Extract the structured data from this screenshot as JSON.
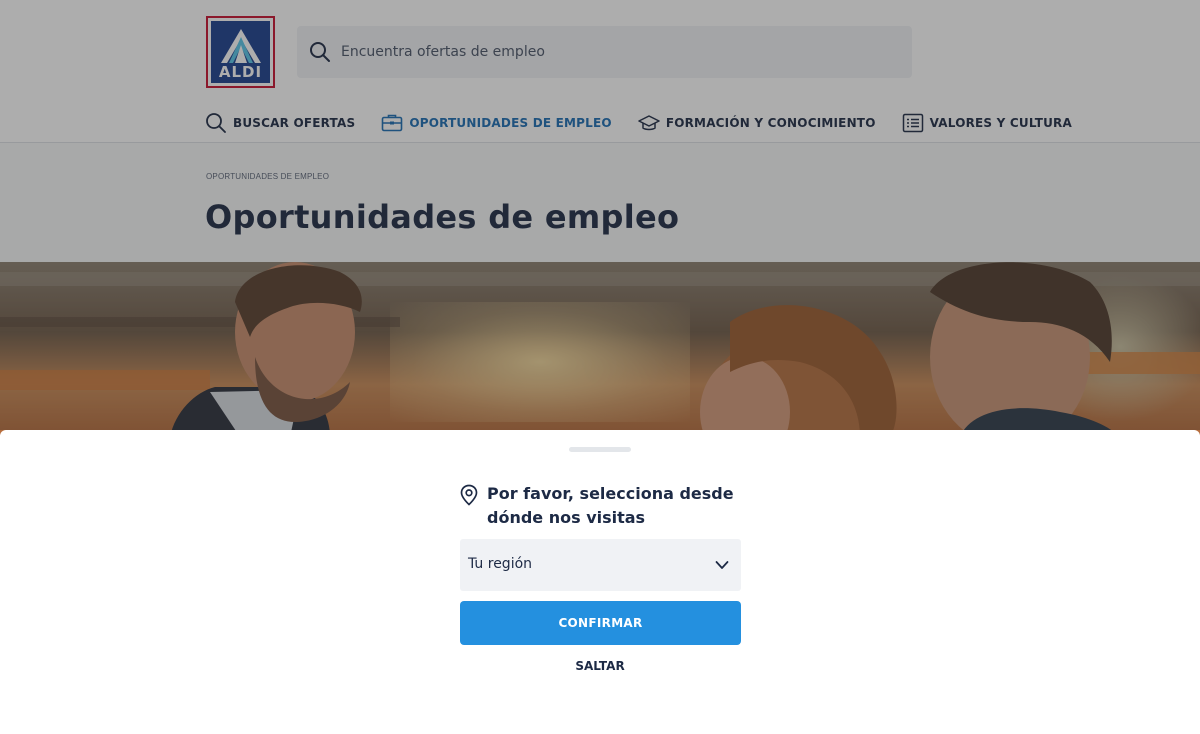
{
  "header": {
    "logo_text": "ALDI",
    "search_placeholder": "Encuentra ofertas de empleo"
  },
  "nav": {
    "items": [
      {
        "label": "BUSCAR OFERTAS",
        "icon": "search-icon",
        "active": false
      },
      {
        "label": "OPORTUNIDADES DE EMPLEO",
        "icon": "briefcase-icon",
        "active": true
      },
      {
        "label": "FORMACIÓN Y CONOCIMIENTO",
        "icon": "graduation-cap-icon",
        "active": false
      },
      {
        "label": "VALORES Y CULTURA",
        "icon": "list-icon",
        "active": false
      }
    ]
  },
  "breadcrumb": "OPORTUNIDADES DE EMPLEO",
  "page_title": "Oportunidades de empleo",
  "modal": {
    "prompt": "Por favor, selecciona desde dónde nos visitas",
    "region_select": {
      "value": "Tu región"
    },
    "confirm_label": "CONFIRMAR",
    "skip_label": "SALTAR"
  },
  "colors": {
    "accent": "#2490df",
    "nav_active": "#1b6cb3",
    "text": "#1d2a45",
    "logo_border": "#c8102e",
    "logo_blue": "#1b3f8f"
  }
}
